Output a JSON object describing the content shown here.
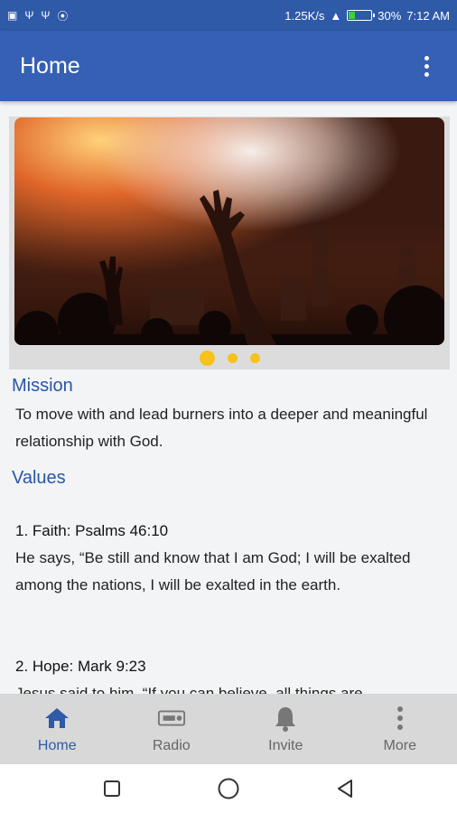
{
  "status_bar": {
    "speed": "1.25K/s",
    "battery": "30%",
    "battery_level": 0.3,
    "time": "7:12 AM",
    "left_icons": [
      "screenshot-icon",
      "usb-icon",
      "usb-icon",
      "hotspot-icon"
    ]
  },
  "app_bar": {
    "title": "Home",
    "menu_icon": "overflow-menu-icon"
  },
  "carousel": {
    "image_description_icon": "concert-worship-photo",
    "slide_count": 3,
    "active_index": 0
  },
  "mission": {
    "title": "Mission",
    "text": "To move with and lead burners into a deeper and meaningful relationship with God."
  },
  "values": {
    "title": "Values",
    "items": [
      {
        "heading": "1. Faith: Psalms 46:10",
        "body": " He says, “Be still and know that I am God; I will be exalted among the nations, I will be exalted in the earth."
      },
      {
        "heading": "2. Hope: Mark 9:23",
        "body": "Jesus said to him, “If you can believe, all things are"
      }
    ]
  },
  "bottom_nav": {
    "items": [
      {
        "label": "Home",
        "icon": "home-icon",
        "active": true
      },
      {
        "label": "Radio",
        "icon": "radio-icon",
        "active": false
      },
      {
        "label": "Invite",
        "icon": "bell-icon",
        "active": false
      },
      {
        "label": "More",
        "icon": "more-vertical-icon",
        "active": false
      }
    ]
  },
  "colors": {
    "primary": "#3560b3",
    "status": "#2f5aa8",
    "accent_dot": "#f6c21b",
    "section_title": "#2a55a5"
  }
}
